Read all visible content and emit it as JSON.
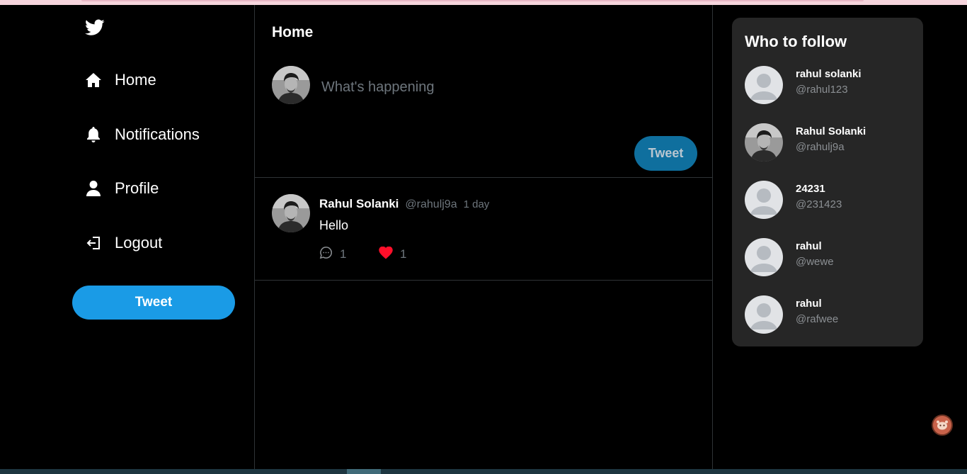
{
  "sidebar": {
    "logo_icon": "twitter-bird-icon",
    "items": [
      {
        "label": "Home",
        "icon": "home-icon"
      },
      {
        "label": "Notifications",
        "icon": "bell-icon"
      },
      {
        "label": "Profile",
        "icon": "user-icon"
      },
      {
        "label": "Logout",
        "icon": "logout-icon"
      }
    ],
    "tweet_button": "Tweet"
  },
  "feed": {
    "title": "Home",
    "compose": {
      "placeholder": "What's happening",
      "value": "",
      "submit_label": "Tweet"
    },
    "posts": [
      {
        "name": "Rahul Solanki",
        "handle": "@rahulj9a",
        "time": "1 day",
        "body": "Hello",
        "replies": "1",
        "likes": "1"
      }
    ]
  },
  "who_to_follow": {
    "title": "Who to follow",
    "users": [
      {
        "name": "rahul solanki",
        "handle": "@rahul123",
        "avatar": "default-avatar"
      },
      {
        "name": "Rahul Solanki",
        "handle": "@rahulj9a",
        "avatar": "photo-avatar"
      },
      {
        "name": "24231",
        "handle": "@231423",
        "avatar": "default-avatar"
      },
      {
        "name": "rahul",
        "handle": "@wewe",
        "avatar": "default-avatar"
      },
      {
        "name": "rahul",
        "handle": "@rafwee",
        "avatar": "default-avatar"
      }
    ]
  },
  "colors": {
    "background": "#000000",
    "accent": "#1a9be6",
    "panel": "#262626",
    "like": "#e0245e",
    "muted_text": "#6e767d"
  }
}
